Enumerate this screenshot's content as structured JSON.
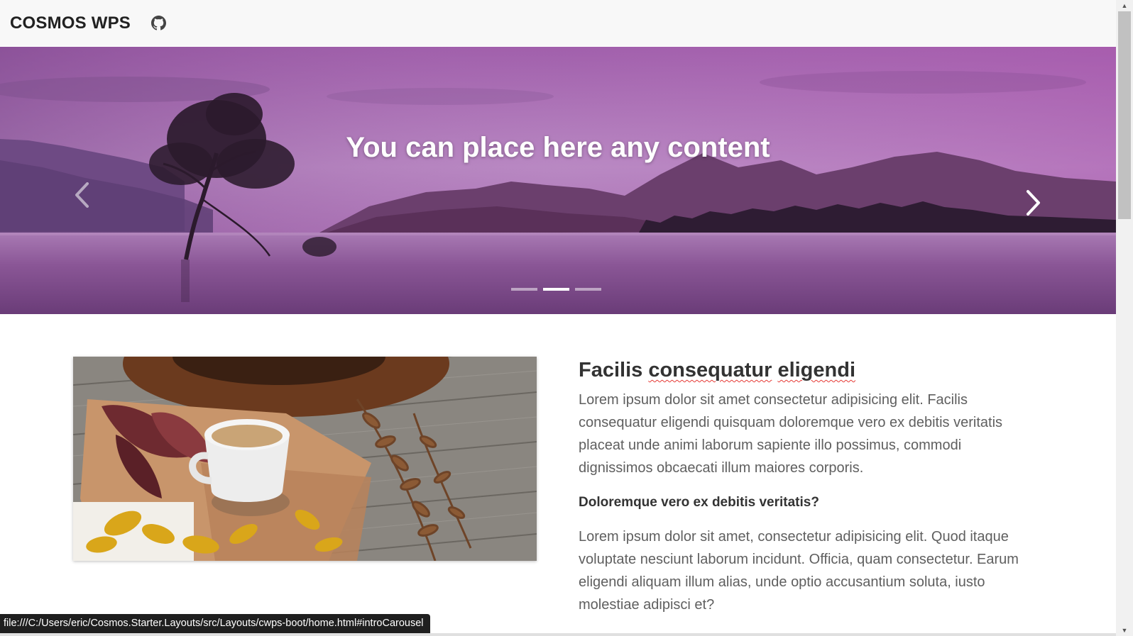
{
  "navbar": {
    "brand": "COSMOS WPS",
    "github_icon": "github-icon"
  },
  "carousel": {
    "caption": "You can place here any content",
    "prev_icon": "chevron-left-icon",
    "next_icon": "chevron-right-icon",
    "slide_count": 3,
    "active_slide": 2
  },
  "article": {
    "heading": [
      "Facilis",
      "consequatur",
      "eligendi"
    ],
    "paragraph1": "Lorem ipsum dolor sit amet consectetur adipisicing elit. Facilis consequatur eligendi quisquam doloremque vero ex debitis veritatis placeat unde animi laborum sapiente illo possimus, commodi dignissimos obcaecati illum maiores corporis.",
    "subheading": "Doloremque vero ex debitis veritatis?",
    "paragraph2": "Lorem ipsum dolor sit amet, consectetur adipisicing elit. Quod itaque voluptate nesciunt laborum incidunt. Officia, quam consectetur. Earum eligendi aliquam illum alias, unde optio accusantium soluta, iusto molestiae adipisci et?"
  },
  "status_bar": {
    "url": "file:///C:/Users/eric/Cosmos.Starter.Layouts/src/Layouts/cwps-boot/home.html#introCarousel"
  },
  "colors": {
    "navbar_bg": "#f8f8f8",
    "carousel_tint": "#8e3f9e",
    "spellcheck_underline": "#e53935"
  }
}
